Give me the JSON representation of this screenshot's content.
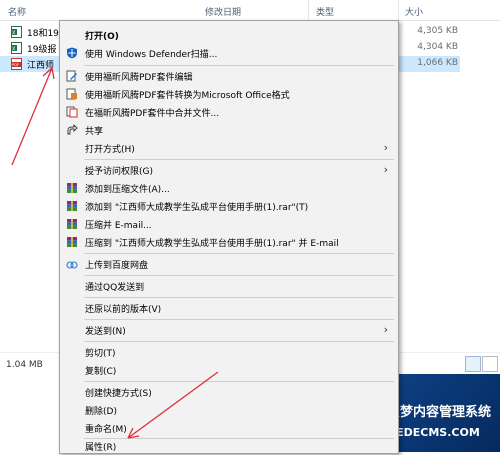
{
  "header": {
    "name": "名称",
    "date": "修改日期",
    "type": "类型",
    "size": "大小"
  },
  "files": [
    {
      "name": "18和19",
      "size": "4,305 KB",
      "selected": false
    },
    {
      "name": "19级报",
      "size": "4,304 KB",
      "selected": false
    },
    {
      "name": "江西师",
      "size": "1,066 KB",
      "selected": true
    }
  ],
  "status": {
    "selection_size": "1.04 MB"
  },
  "menu": {
    "open": "打开(O)",
    "defender": "使用 Windows Defender扫描...",
    "foxit_edit": "使用福昕风腾PDF套件编辑",
    "foxit_convert": "使用福昕风腾PDF套件转换为Microsoft Office格式",
    "foxit_merge": "在福昕风腾PDF套件中合并文件...",
    "share": "共享",
    "open_with": "打开方式(H)",
    "grant_access": "授予访问权限(G)",
    "add_archive": "添加到压缩文件(A)...",
    "add_rar": "添加到 \"江西师大成教学生弘成平台使用手册(1).rar\"(T)",
    "compress_email": "压缩并 E-mail...",
    "compress_rar_email": "压缩到 \"江西师大成教学生弘成平台使用手册(1).rar\" 并 E-mail",
    "baidu": "上传到百度网盘",
    "qq": "通过QQ发送到",
    "restore": "还原以前的版本(V)",
    "send_to": "发送到(N)",
    "cut": "剪切(T)",
    "copy": "复制(C)",
    "shortcut": "创建快捷方式(S)",
    "delete": "删除(D)",
    "rename": "重命名(M)",
    "properties": "属性(R)",
    "arrow": "›"
  },
  "colors": {
    "selection": "#cce8ff",
    "annotation_arrow": "#e0303a",
    "menu_bg": "#f2f2f2"
  }
}
